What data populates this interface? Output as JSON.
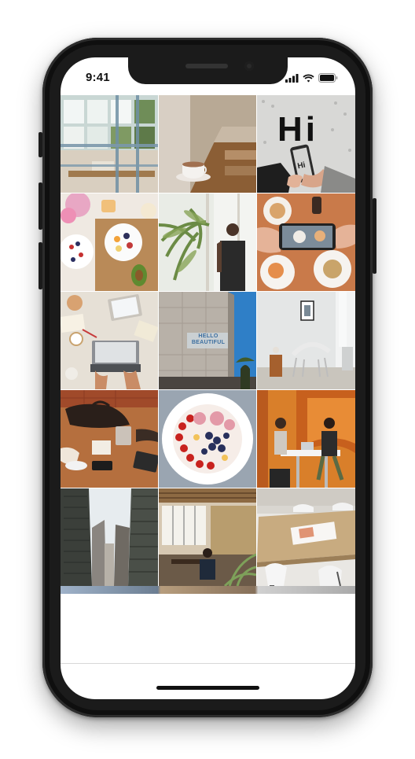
{
  "status_bar": {
    "time": "9:41",
    "icons": [
      "signal-icon",
      "wifi-icon",
      "battery-icon"
    ]
  },
  "gallery": {
    "photos": [
      {
        "subject": "cafe-interior-window-photo"
      },
      {
        "subject": "coffee-cup-on-table-photo"
      },
      {
        "subject": "hand-holding-phone-hi-photo"
      },
      {
        "subject": "breakfast-table-flatlay-photo"
      },
      {
        "subject": "man-by-window-plants-photo"
      },
      {
        "subject": "phone-photographing-food-photo"
      },
      {
        "subject": "workspace-laptop-flatlay-photo"
      },
      {
        "subject": "hello-beautiful-wall-photo",
        "text": "HELLO BEAUTIFUL"
      },
      {
        "subject": "white-chair-room-photo"
      },
      {
        "subject": "meeting-table-bag-photo"
      },
      {
        "subject": "fruit-bowl-photo"
      },
      {
        "subject": "office-meeting-laptop-photo"
      },
      {
        "subject": "city-buildings-photo"
      },
      {
        "subject": "office-interior-man-photo"
      },
      {
        "subject": "table-chairs-magazine-photo"
      }
    ]
  },
  "colors": {
    "phone_body": "#1b1b1b",
    "screen_background": "#ffffff",
    "text": "#111111"
  }
}
